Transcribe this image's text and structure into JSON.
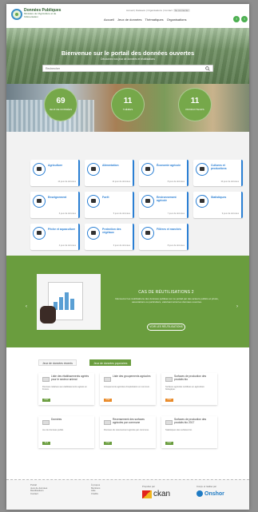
{
  "header": {
    "brand": "Données Publiques",
    "ministry": "Ministère de l'Agriculture et de l'Alimentation",
    "top_links": "Accueil | Datasets | Organisations | Contact",
    "top_highlight": "Se connecter",
    "nav": [
      "Accueil",
      "Jeux de données",
      "Thématiques",
      "Organisations"
    ],
    "social": [
      "f",
      "t"
    ]
  },
  "hero": {
    "title": "Bienvenue sur le portail des données ouvertes",
    "subtitle": "Découvrez nos jeux de données et réutilisations",
    "search_placeholder": "Rechercher"
  },
  "stats": [
    {
      "number": "69",
      "label": "JEUX DE DONNÉES"
    },
    {
      "number": "11",
      "label": "THÈMES"
    },
    {
      "number": "11",
      "label": "PRODUCTEURS"
    }
  ],
  "categories": [
    {
      "title": "Agriculture",
      "count": "14 jeux de données"
    },
    {
      "title": "Alimentation",
      "count": "12 jeux de données"
    },
    {
      "title": "Économie agricole",
      "count": "8 jeux de données"
    },
    {
      "title": "Cultures et productions",
      "count": "10 jeux de données"
    },
    {
      "title": "Enseignement",
      "count": "6 jeux de données"
    },
    {
      "title": "Forêt",
      "count": "5 jeux de données"
    },
    {
      "title": "Environnement agricole",
      "count": "7 jeux de données"
    },
    {
      "title": "Statistiques",
      "count": "9 jeux de données"
    },
    {
      "title": "Pêche et aquaculture",
      "count": "4 jeux de données"
    },
    {
      "title": "Protection des végétaux",
      "count": "6 jeux de données"
    },
    {
      "title": "Filières et marchés",
      "count": "8 jeux de données"
    }
  ],
  "reuse": {
    "title": "CAS DE RÉUTILISATIONS 2",
    "text": "Découvrez les réutilisations des données publiées sur ce portail par des acteurs publics et privés, associations ou particuliers, valorisant ainsi les données ouvertes.",
    "button": "VOIR LES RÉUTILISATIONS",
    "prev": "‹",
    "next": "›"
  },
  "datasets": {
    "tab_recent": "Jeux de données récents",
    "tab_popular": "Jeux de données populaires",
    "items": [
      {
        "title": "Liste des établissements agréés pour le secteur animal",
        "desc": "Données relatives aux établissements agréés en France.",
        "badge": "CSV"
      },
      {
        "title": "Liste des groupements agricoles",
        "desc": "Groupements agricoles d'exploitation en commun.",
        "badge": "CSV"
      },
      {
        "title": "Surfaces de production des produits bio",
        "desc": "Surfaces agricoles certifiées en agriculture biologique.",
        "badge": "CSV"
      },
      {
        "title": "Données",
        "desc": "Jeu de données publié.",
        "badge": "XLS"
      },
      {
        "title": "Recensement des surfaces agricoles par commune",
        "desc": "Données du recensement agricole par commune.",
        "badge": "CSV"
      },
      {
        "title": "Surfaces de production des produits bio 2017",
        "desc": "Statistiques des surfaces bio.",
        "badge": "CSV"
      }
    ]
  },
  "footer": {
    "col1": [
      "Portail",
      "Jeux de données",
      "Réutilisations",
      "Contact"
    ],
    "col2": [
      "À propos",
      "Mentions",
      "Aide",
      "Crédits"
    ],
    "ckan_label": "Propulsé par",
    "ckan_name": "ckan",
    "onshor_label": "Conçu et réalisé par",
    "onshor_name": "Onshor"
  }
}
